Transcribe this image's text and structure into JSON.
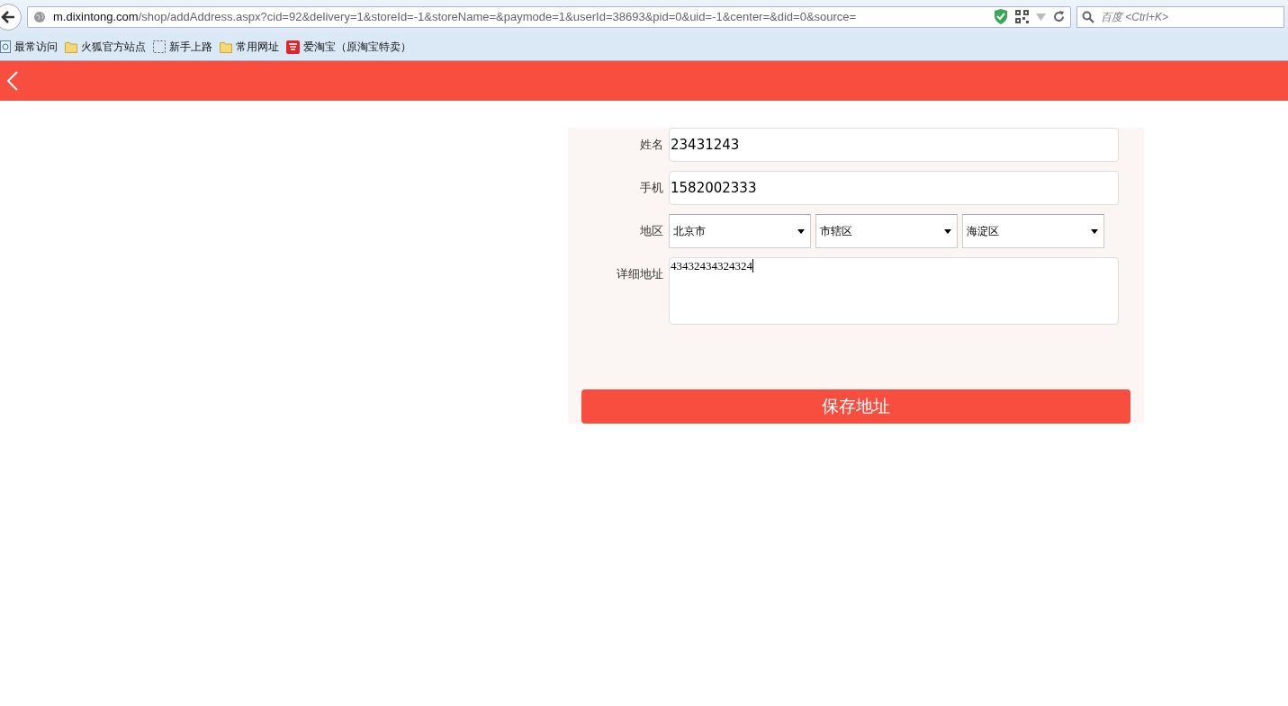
{
  "browser": {
    "url": {
      "domain": "m.dixintong.com",
      "path": "/shop/addAddress.aspx?cid=92&delivery=1&storeId=-1&storeName=&paymode=1&userId=38693&pid=0&uid=-1&center=&did=0&source="
    },
    "search": {
      "placeholder": "百度 <Ctrl+K>"
    }
  },
  "bookmarks": [
    {
      "label": "最常访问",
      "kind": "recent"
    },
    {
      "label": "火狐官方站点",
      "kind": "folder"
    },
    {
      "label": "新手上路",
      "kind": "page"
    },
    {
      "label": "常用网址",
      "kind": "folder"
    },
    {
      "label": "爱淘宝（原淘宝特卖）",
      "kind": "taobao"
    }
  ],
  "form": {
    "fields": [
      {
        "label": "姓名",
        "kind": "text",
        "value": "23431243"
      },
      {
        "label": "手机",
        "kind": "text",
        "value": "1582002333"
      },
      {
        "label": "地区",
        "kind": "selects",
        "options": [
          "北京市",
          "市辖区",
          "海淀区"
        ]
      },
      {
        "label": "详细地址",
        "kind": "textarea",
        "value": "43432434324324"
      }
    ],
    "save_button": "保存地址"
  }
}
